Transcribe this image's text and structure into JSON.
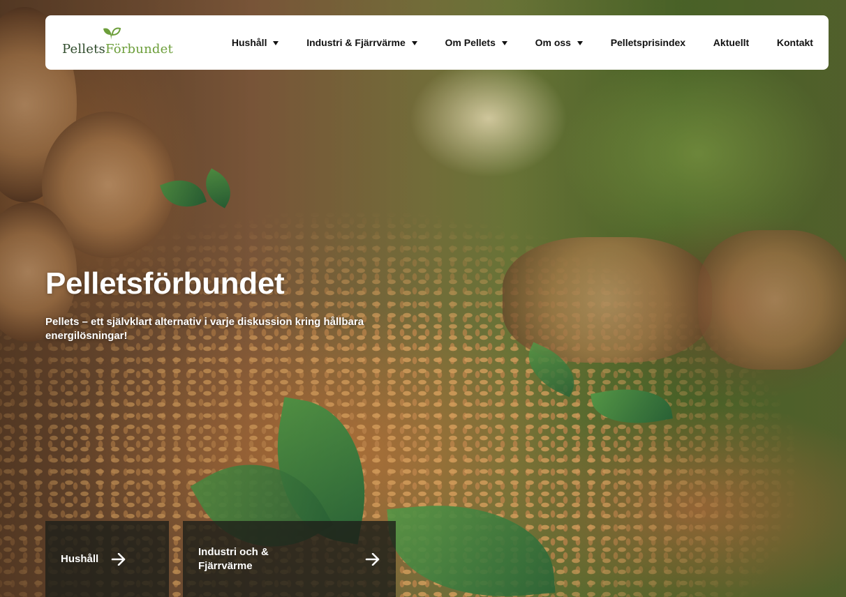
{
  "logo": {
    "text_part1": "Pellets",
    "text_part2": "F",
    "text_part3": "örbundet"
  },
  "nav": {
    "items": [
      {
        "label": "Hushåll",
        "has_dropdown": true
      },
      {
        "label": "Industri & Fjärrvärme",
        "has_dropdown": true
      },
      {
        "label": "Om Pellets",
        "has_dropdown": true
      },
      {
        "label": "Om oss",
        "has_dropdown": true
      },
      {
        "label": "Pelletsprisindex",
        "has_dropdown": false
      },
      {
        "label": "Aktuellt",
        "has_dropdown": false
      },
      {
        "label": "Kontakt",
        "has_dropdown": false
      }
    ]
  },
  "hero": {
    "title": "Pelletsförbundet",
    "subtitle": "Pellets – ett självklart alternativ i varje diskussion kring hållbara energilösningar!"
  },
  "cards": [
    {
      "label": "Hushåll"
    },
    {
      "label": "Industri och & Fjärrvärme"
    }
  ],
  "colors": {
    "logo_dark": "#2e4a2a",
    "logo_green": "#6c9e3a",
    "card_bg": "#1e201a"
  }
}
